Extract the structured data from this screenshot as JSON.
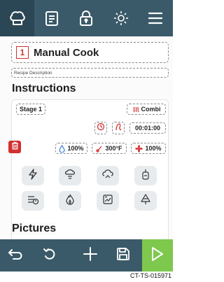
{
  "header": {
    "tabs": [
      {
        "icon": "chef-hat-icon",
        "active": true
      },
      {
        "icon": "clipboard-icon",
        "active": false
      },
      {
        "icon": "lock-icon",
        "active": false
      },
      {
        "icon": "brightness-icon",
        "active": false
      },
      {
        "icon": "menu-icon",
        "active": false
      }
    ]
  },
  "recipe": {
    "step_number": "1",
    "name": "Manual Cook",
    "description_placeholder": "Recipe Description"
  },
  "instructions": {
    "title": "Instructions",
    "stage_label": "Stage 1",
    "mode_label": "Combi",
    "time": "00:01:00",
    "humidity": "100%",
    "temperature": "300°F",
    "fan_speed": "100%"
  },
  "functions": [
    {
      "icon": "lightning-icon"
    },
    {
      "icon": "cooking-function-icon"
    },
    {
      "icon": "rethermalize-icon"
    },
    {
      "icon": "probe-icon"
    },
    {
      "icon": "steam-clean-icon"
    },
    {
      "icon": "flame-icon"
    },
    {
      "icon": "oven-chart-icon"
    },
    {
      "icon": "tree-icon"
    }
  ],
  "pictures": {
    "title": "Pictures"
  },
  "footer": {
    "buttons": [
      "back-icon",
      "undo-icon",
      "add-icon",
      "save-icon",
      "play-icon"
    ],
    "code": "CT-TS-015971"
  },
  "colors": {
    "header_bg": "#3b5a69",
    "accent_red": "#d32f2f",
    "play_green": "#7ec84e",
    "function_bg": "#e7ebee"
  }
}
